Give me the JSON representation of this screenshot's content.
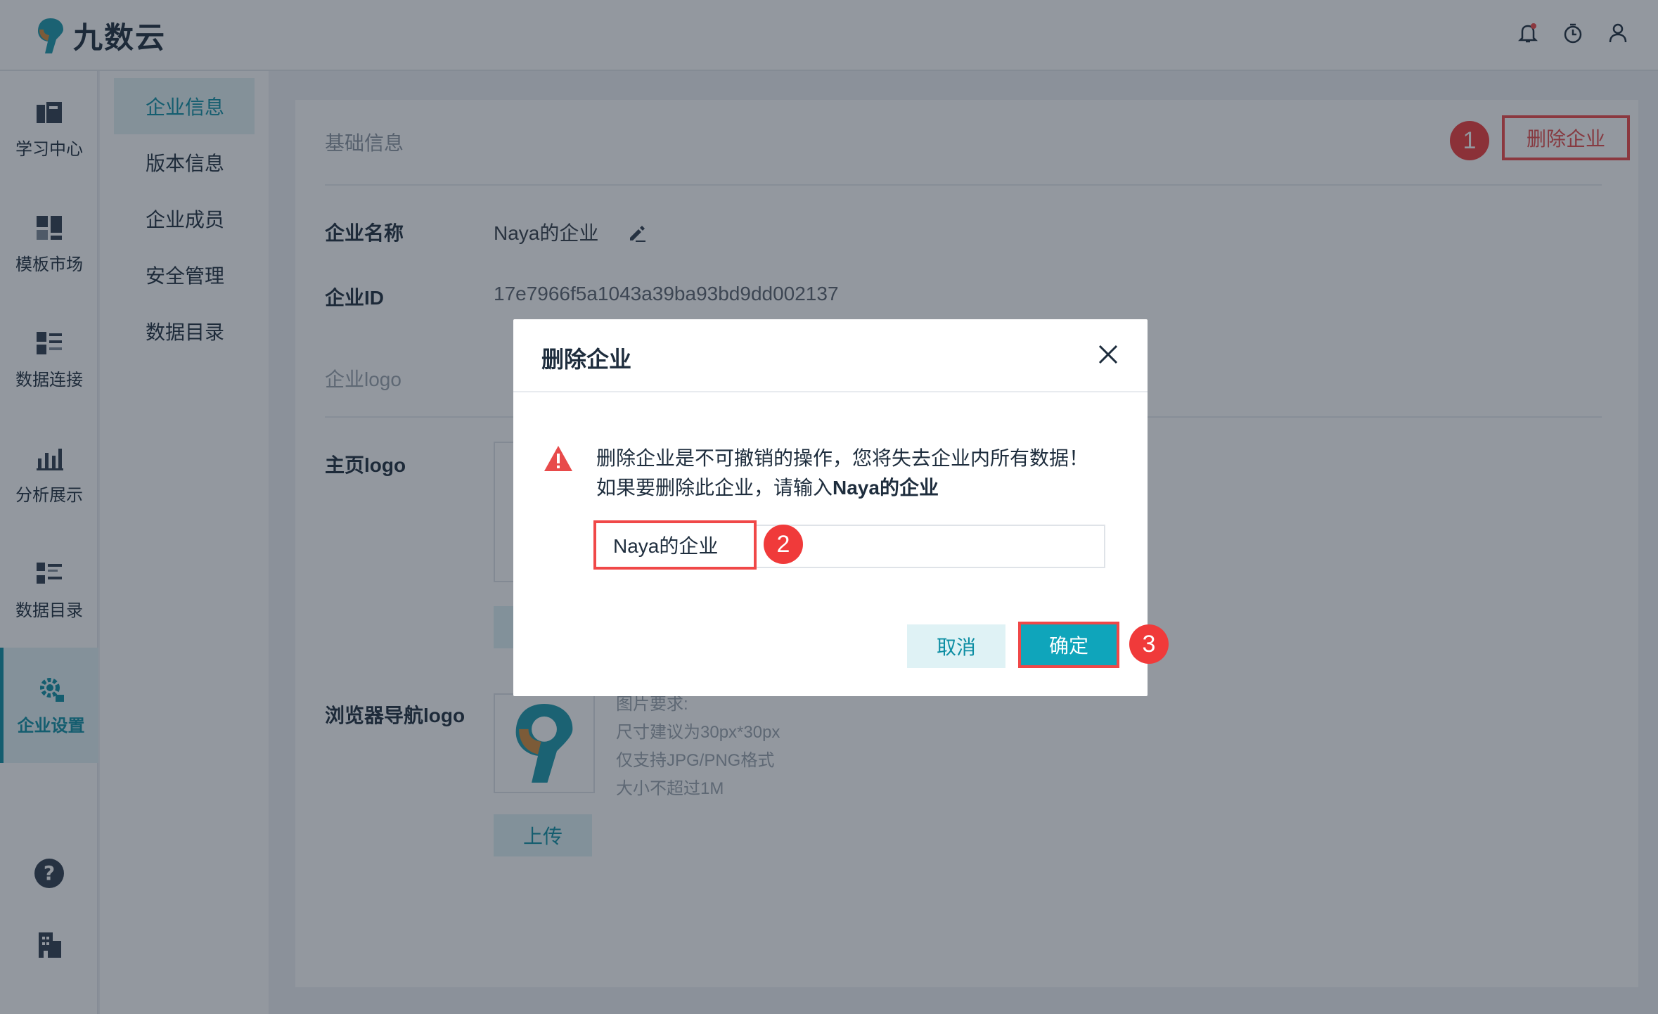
{
  "app": {
    "brand": "九数云"
  },
  "header": {
    "icons": [
      "bell-icon",
      "timer-icon",
      "user-icon"
    ]
  },
  "leftnav": {
    "items": [
      {
        "label": "学习中心",
        "icon": "book-icon"
      },
      {
        "label": "模板市场",
        "icon": "template-icon"
      },
      {
        "label": "数据连接",
        "icon": "data-connect-icon"
      },
      {
        "label": "分析展示",
        "icon": "chart-icon"
      },
      {
        "label": "数据目录",
        "icon": "catalog-icon"
      },
      {
        "label": "企业设置",
        "icon": "settings-icon",
        "active": true
      }
    ],
    "bottom_icons": [
      "help-icon",
      "building-icon"
    ]
  },
  "submenu": {
    "items": [
      {
        "label": "企业信息",
        "active": true
      },
      {
        "label": "版本信息"
      },
      {
        "label": "企业成员"
      },
      {
        "label": "安全管理"
      },
      {
        "label": "数据目录"
      }
    ]
  },
  "main": {
    "section_title": "基础信息",
    "delete_link": "删除企业",
    "company_name_label": "企业名称",
    "company_name_value": "Naya的企业",
    "company_id_label": "企业ID",
    "company_id_value": "17e7966f5a1043a39ba93bd9dd002137",
    "logo_section": "企业logo",
    "homepage_logo_label": "主页logo",
    "browser_logo_label": "浏览器导航logo",
    "upload_label": "上传",
    "requirements": [
      "图片要求:",
      "尺寸建议为30px*30px",
      "仅支持JPG/PNG格式",
      "大小不超过1M"
    ]
  },
  "modal": {
    "title": "删除企业",
    "warning_line1": "删除企业是不可撤销的操作，您将失去企业内所有数据！",
    "warning_line2_prefix": "如果要删除此企业，请输入",
    "warning_line2_bold": "Naya的企业",
    "input_value": "Naya的企业",
    "cancel_label": "取消",
    "confirm_label": "确定"
  },
  "badges": [
    "1",
    "2",
    "3"
  ],
  "colors": {
    "accent": "#0fa5bb",
    "highlight": "#f04848",
    "badge": "#f03a3a"
  }
}
